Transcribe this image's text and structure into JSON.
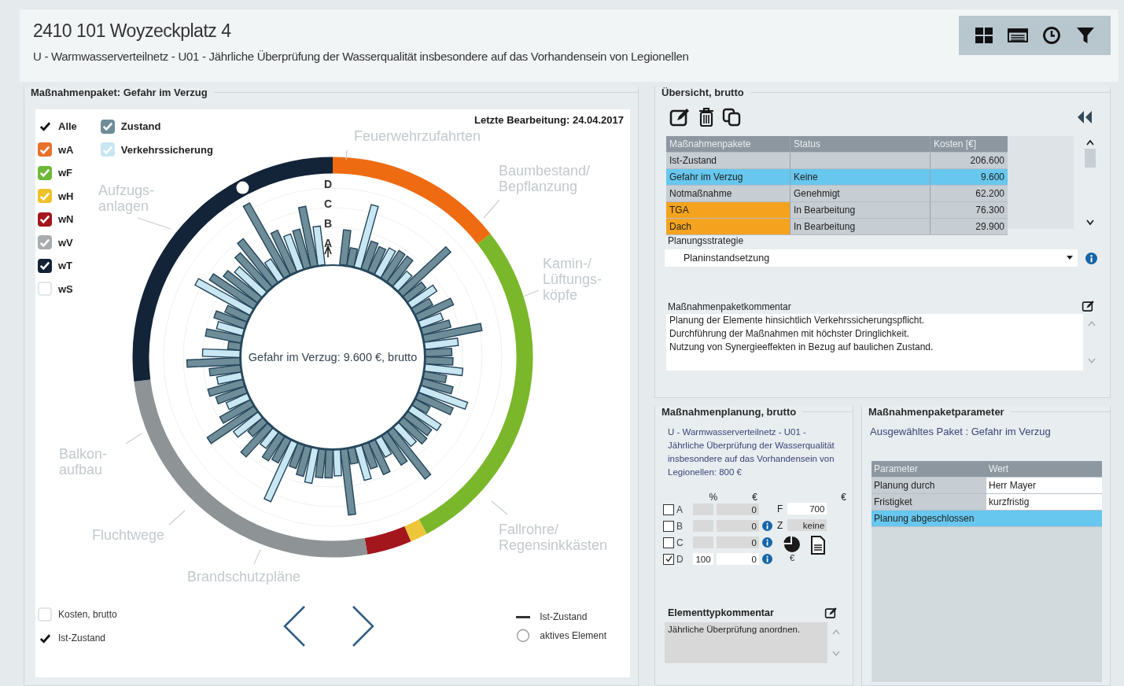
{
  "header": {
    "title": "2410 101 Woyzeckplatz 4",
    "subtitle": "U - Warmwasserverteilnetz - U01 - Jährliche Überprüfung der Wasserqualität insbesondere auf das Vorhandensein von Legionellen"
  },
  "package_panel": {
    "title": "Maßnahmenpaket: Gefahr im Verzug",
    "last_edit": "Letzte Bearbeitung: 24.04.2017",
    "filters": [
      {
        "label": "Alle",
        "kind": "plain",
        "checked": true
      },
      {
        "label": "wA",
        "kind": "box",
        "color": "#e8702a",
        "checked": true
      },
      {
        "label": "wF",
        "kind": "box",
        "color": "#6fb83a",
        "checked": true
      },
      {
        "label": "wH",
        "kind": "box",
        "color": "#efc12a",
        "checked": true
      },
      {
        "label": "wN",
        "kind": "box",
        "color": "#a3161c",
        "checked": true
      },
      {
        "label": "wV",
        "kind": "box",
        "color": "#a9acae",
        "checked": true
      },
      {
        "label": "wT",
        "kind": "box",
        "color": "#142236",
        "checked": true
      },
      {
        "label": "wS",
        "kind": "box",
        "color": "#ffffff",
        "checked": false
      }
    ],
    "layers": [
      {
        "label": "Zustand",
        "color": "#6e8d99",
        "checked": true
      },
      {
        "label": "Verkehrssicherung",
        "color": "#c9e6f3",
        "checked": true
      }
    ],
    "center_text": "Gefahr im Verzug: 9.600 €, brutto",
    "axis_labels": [
      "D",
      "C",
      "B",
      "A"
    ],
    "categories": [
      {
        "lines": [
          "Feuerwehrzufahrten"
        ]
      },
      {
        "lines": [
          "Baumbestand/",
          "Bepflanzung"
        ]
      },
      {
        "lines": [
          "Kamin-/",
          "Lüftungs-",
          "köpfe"
        ]
      },
      {
        "lines": [
          "Fallrohre/",
          "Regensinkkästen"
        ]
      },
      {
        "lines": [
          "Brandschutzpläne"
        ]
      },
      {
        "lines": [
          "Fluchtwege"
        ]
      },
      {
        "lines": [
          "Balkon-",
          "aufbau"
        ]
      },
      {
        "lines": [
          "Aufzugs-",
          "anlagen"
        ]
      }
    ],
    "options": [
      {
        "label": "Kosten, brutto",
        "kind": "box",
        "checked": false
      },
      {
        "label": "Ist-Zustand",
        "kind": "plain",
        "checked": true
      }
    ],
    "legend": [
      {
        "label": "Ist-Zustand",
        "kind": "line"
      },
      {
        "label": "aktives Element",
        "kind": "circle"
      }
    ]
  },
  "overview": {
    "title": "Übersicht, brutto",
    "columns": [
      "Maßnahmenpakete",
      "Status",
      "Kosten [€]"
    ],
    "rows": [
      {
        "name": "Ist-Zustand",
        "status": "",
        "cost": "206.600",
        "selected": false
      },
      {
        "name": "Gefahr im Verzug",
        "status": "Keine",
        "cost": "9.600",
        "selected": true
      },
      {
        "name": "Notmaßnahme",
        "status": "Genehmigt",
        "cost": "62.200",
        "selected": false
      },
      {
        "name": "TGA",
        "status": "In Bearbeitung",
        "cost": "76.300",
        "selected": false,
        "color": "#f5a31e"
      },
      {
        "name": "Dach",
        "status": "In Bearbeitung",
        "cost": "29.900",
        "selected": false,
        "color": "#f5a31e"
      }
    ],
    "strategy_label": "Planungsstrategie",
    "strategy_value": "Planinstandsetzung",
    "comment_label": "Maßnahmenpaketkommentar",
    "comment_lines": [
      "Planung der Elemente hinsichtlich Verkehrssicherungspflicht.",
      "Durchführung der Maßnahmen mit höchster Dringlichkeit.",
      "Nutzung von Synergieeffekten in Bezug auf baulichen Zustand."
    ]
  },
  "planning": {
    "title": "Maßnahmenplanung, brutto",
    "description": "U - Warmwasserverteilnetz - U01 - Jährliche Überprüfung der Wasserqualität insbesondere auf das Vorhandensein von Legionellen: 800 €",
    "headers": [
      "%",
      "€",
      "€"
    ],
    "levels": [
      {
        "letter": "A",
        "checked": false,
        "disabled": true,
        "amount": "0",
        "info": false
      },
      {
        "letter": "B",
        "checked": false,
        "disabled": true,
        "amount": "0",
        "info": true
      },
      {
        "letter": "C",
        "checked": false,
        "disabled": true,
        "amount": "0",
        "info": true
      },
      {
        "letter": "D",
        "checked": true,
        "disabled": false,
        "percent": "100",
        "amount": "0",
        "info": true
      }
    ],
    "extras": [
      {
        "label": "F",
        "value": "700",
        "disabled": false
      },
      {
        "label": "Z",
        "value": "keine",
        "disabled": true
      }
    ],
    "pie_unit": "€",
    "comment_label": "Elementtypkommentar",
    "comment": "Jährliche Überprüfung anordnen."
  },
  "parameters": {
    "title": "Maßnahmenpaketparameter",
    "selected_package": "Ausgewähltes Paket : Gefahr im Verzug",
    "columns": [
      "Parameter",
      "Wert"
    ],
    "rows": [
      {
        "name": "Planung durch",
        "value": "Herr Mayer",
        "selected": false
      },
      {
        "name": "Fristigket",
        "value": "kurzfristig",
        "selected": false
      },
      {
        "name": "Planung abgeschlossen",
        "selected": true
      }
    ]
  }
}
